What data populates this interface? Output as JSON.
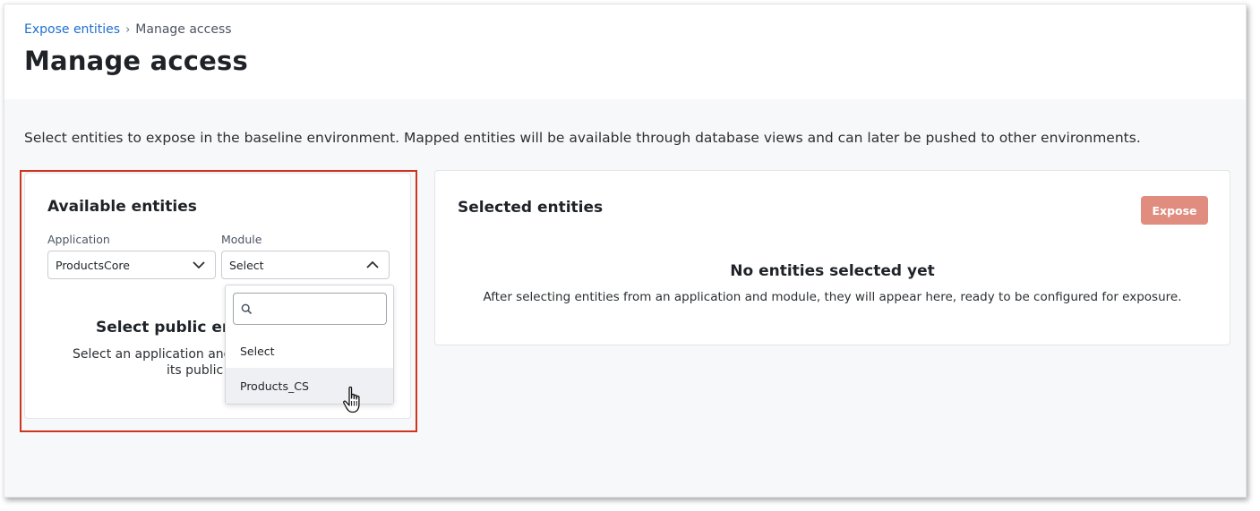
{
  "breadcrumb": {
    "parent": "Expose entities",
    "separator": "›",
    "current": "Manage access"
  },
  "page": {
    "title": "Manage access",
    "intro": "Select entities to expose in the baseline environment. Mapped entities will be available through database views and can later be pushed to other environments."
  },
  "available": {
    "title": "Available entities",
    "application_label": "Application",
    "application_value": "ProductsCore",
    "module_label": "Module",
    "module_value": "Select",
    "empty_title": "Select public ent",
    "empty_line1": "Select an application and",
    "empty_line2": "its public"
  },
  "module_dropdown": {
    "search_placeholder": "",
    "options": [
      "Select",
      "Products_CS"
    ],
    "hovered_option": "Products_CS"
  },
  "selected": {
    "title": "Selected entities",
    "expose_label": "Expose",
    "empty_title": "No entities selected yet",
    "empty_text": "After selecting entities from an application and module, they will appear here, ready to be configured for exposure."
  },
  "colors": {
    "link": "#1f6fd1",
    "highlight_border": "#d0341f",
    "expose_button_disabled": "#e08d80",
    "page_background": "#f7f8fa"
  },
  "icons": {
    "application_select": "chevron-down-icon",
    "module_select": "chevron-up-icon",
    "dropdown_search": "search-icon",
    "pointer": "hand-cursor-icon"
  }
}
